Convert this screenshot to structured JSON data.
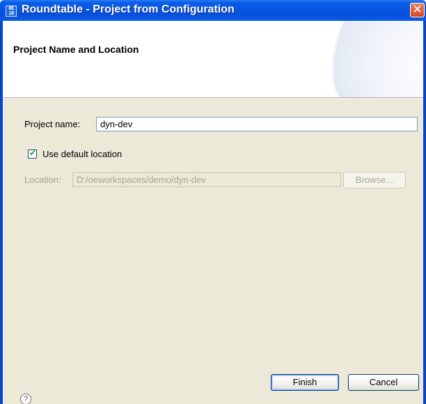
{
  "window": {
    "title": "Roundtable - Project from Configuration",
    "icon_name": "roundtable-app-icon",
    "icon_glyph_top": "0E",
    "icon_glyph_bottom": "10",
    "close_glyph": "✕"
  },
  "banner": {
    "title": "Project Name and Location"
  },
  "form": {
    "project_name_label": "Project name:",
    "project_name_value": "dyn-dev",
    "use_default_label": "Use default location",
    "use_default_checked": true,
    "location_label": "Location:",
    "location_value": "D:/oeworkspaces/demo/dyn-dev",
    "browse_label": "Browse..."
  },
  "footer": {
    "help_glyph": "?",
    "finish_label": "Finish",
    "cancel_label": "Cancel"
  },
  "colors": {
    "titlebar": "#0a5ee8",
    "dialog_bg": "#ece9d8",
    "checkmark": "#21a121"
  }
}
